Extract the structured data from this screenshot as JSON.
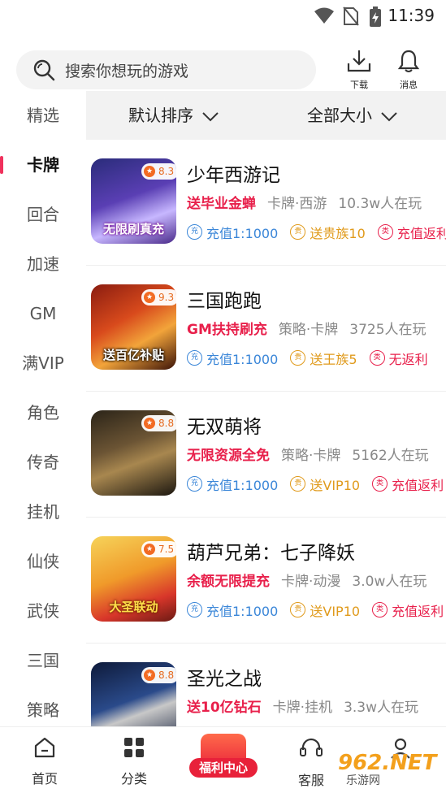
{
  "status_bar": {
    "time": "11:39"
  },
  "search": {
    "placeholder": "搜索你想玩的游戏"
  },
  "header": {
    "download_label": "下载",
    "messages_label": "消息"
  },
  "sidebar": {
    "items": [
      {
        "label": "精选"
      },
      {
        "label": "卡牌"
      },
      {
        "label": "回合"
      },
      {
        "label": "加速"
      },
      {
        "label": "GM"
      },
      {
        "label": "满VIP"
      },
      {
        "label": "角色"
      },
      {
        "label": "传奇"
      },
      {
        "label": "挂机"
      },
      {
        "label": "仙侠"
      },
      {
        "label": "武侠"
      },
      {
        "label": "三国"
      },
      {
        "label": "策略"
      }
    ],
    "active": "卡牌"
  },
  "filters": {
    "sort": "默认排序",
    "size": "全部大小"
  },
  "games": [
    {
      "name": "少年西游记",
      "rating": "8.3",
      "promo": "送毕业金蝉",
      "category": "卡牌·西游",
      "players": "10.3w人在玩",
      "thumb_banner": "无限刷真充",
      "tags": [
        {
          "icon": "充",
          "text": "充值1:1000"
        },
        {
          "icon": "贵",
          "text": "送贵族10"
        },
        {
          "icon": "类",
          "text": "充值返利"
        }
      ]
    },
    {
      "name": "三国跑跑",
      "rating": "9.3",
      "promo": "GM扶持刷充",
      "category": "策略·卡牌",
      "players": "3725人在玩",
      "thumb_banner": "送百亿补贴",
      "tags": [
        {
          "icon": "充",
          "text": "充值1:1000"
        },
        {
          "icon": "贵",
          "text": "送王族5"
        },
        {
          "icon": "类",
          "text": "无返利"
        }
      ]
    },
    {
      "name": "无双萌将",
      "rating": "8.8",
      "promo": "无限资源全免",
      "category": "策略·卡牌",
      "players": "5162人在玩",
      "thumb_banner": "",
      "tags": [
        {
          "icon": "充",
          "text": "充值1:1000"
        },
        {
          "icon": "贵",
          "text": "送VIP10"
        },
        {
          "icon": "类",
          "text": "充值返利"
        }
      ]
    },
    {
      "name": "葫芦兄弟：七子降妖",
      "rating": "7.5",
      "promo": "余额无限提充",
      "category": "卡牌·动漫",
      "players": "3.0w人在玩",
      "thumb_banner": "大圣联动",
      "tags": [
        {
          "icon": "充",
          "text": "充值1:1000"
        },
        {
          "icon": "贵",
          "text": "送VIP10"
        },
        {
          "icon": "类",
          "text": "充值返利"
        }
      ]
    },
    {
      "name": "圣光之战",
      "rating": "8.8",
      "promo": "送10亿钻石",
      "category": "卡牌·挂机",
      "players": "3.3w人在玩",
      "thumb_banner": "",
      "tags": []
    }
  ],
  "bottom_nav": {
    "home": "首页",
    "category": "分类",
    "welfare": "福利中心",
    "service": "客服"
  },
  "watermark": {
    "number": "962.NET",
    "text": "乐游网"
  },
  "colors": {
    "accent_red": "#e8204b",
    "tag_blue": "#3a86d8",
    "tag_gold": "#e09a1b",
    "rating_orange": "#e66a1f"
  }
}
